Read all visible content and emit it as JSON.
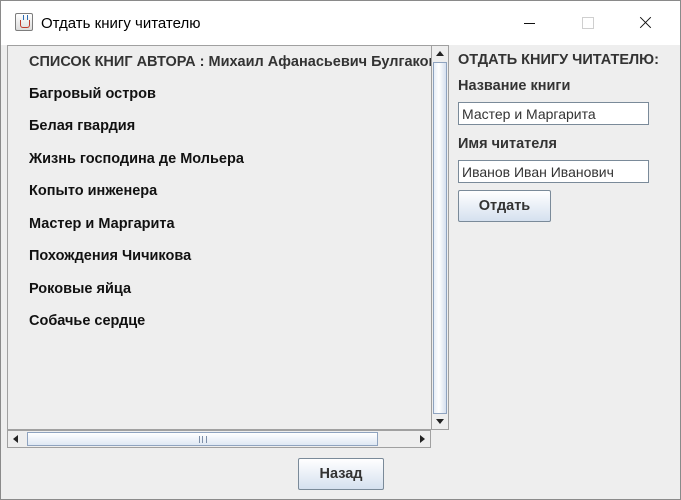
{
  "window": {
    "title": "Отдать книгу читателю",
    "icon": "java-icon"
  },
  "books_list": {
    "header": "СПИСОК КНИГ АВТОРА : Михаил Афанасьевич Булгаков",
    "items": [
      "Багровый остров",
      "Белая гвардия",
      "Жизнь господина де Мольера",
      "Копыто инженера",
      "Мастер и Маргарита",
      "Похождения Чичикова",
      "Роковые яйца",
      "Собачье сердце"
    ]
  },
  "give_form": {
    "title": "ОТДАТЬ КНИГУ ЧИТАТЕЛЮ:",
    "book_label": "Название книги",
    "book_value": "Мастер и Маргарита",
    "reader_label": "Имя читателя",
    "reader_value": "Иванов Иван Иванович",
    "submit_label": "Отдать"
  },
  "footer": {
    "back_label": "Назад"
  }
}
